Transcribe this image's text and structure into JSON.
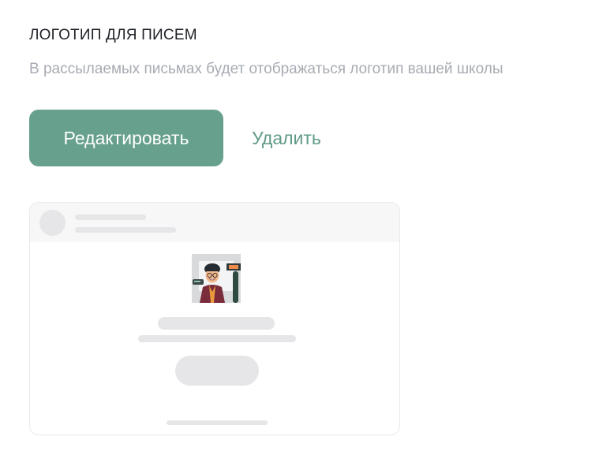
{
  "logo_section": {
    "title": "ЛОГОТИП ДЛЯ ПИСЕМ",
    "description": "В рассылаемых письмах будет отображаться логотип вашей школы",
    "edit_label": "Редактировать",
    "delete_label": "Удалить"
  },
  "colors": {
    "accent": "#67a08d",
    "accent_text": "#5f9a86",
    "muted_text": "#a7abb3",
    "placeholder": "#e6e6e8"
  },
  "preview": {
    "logo_image": "teacher-illustration-logo"
  }
}
